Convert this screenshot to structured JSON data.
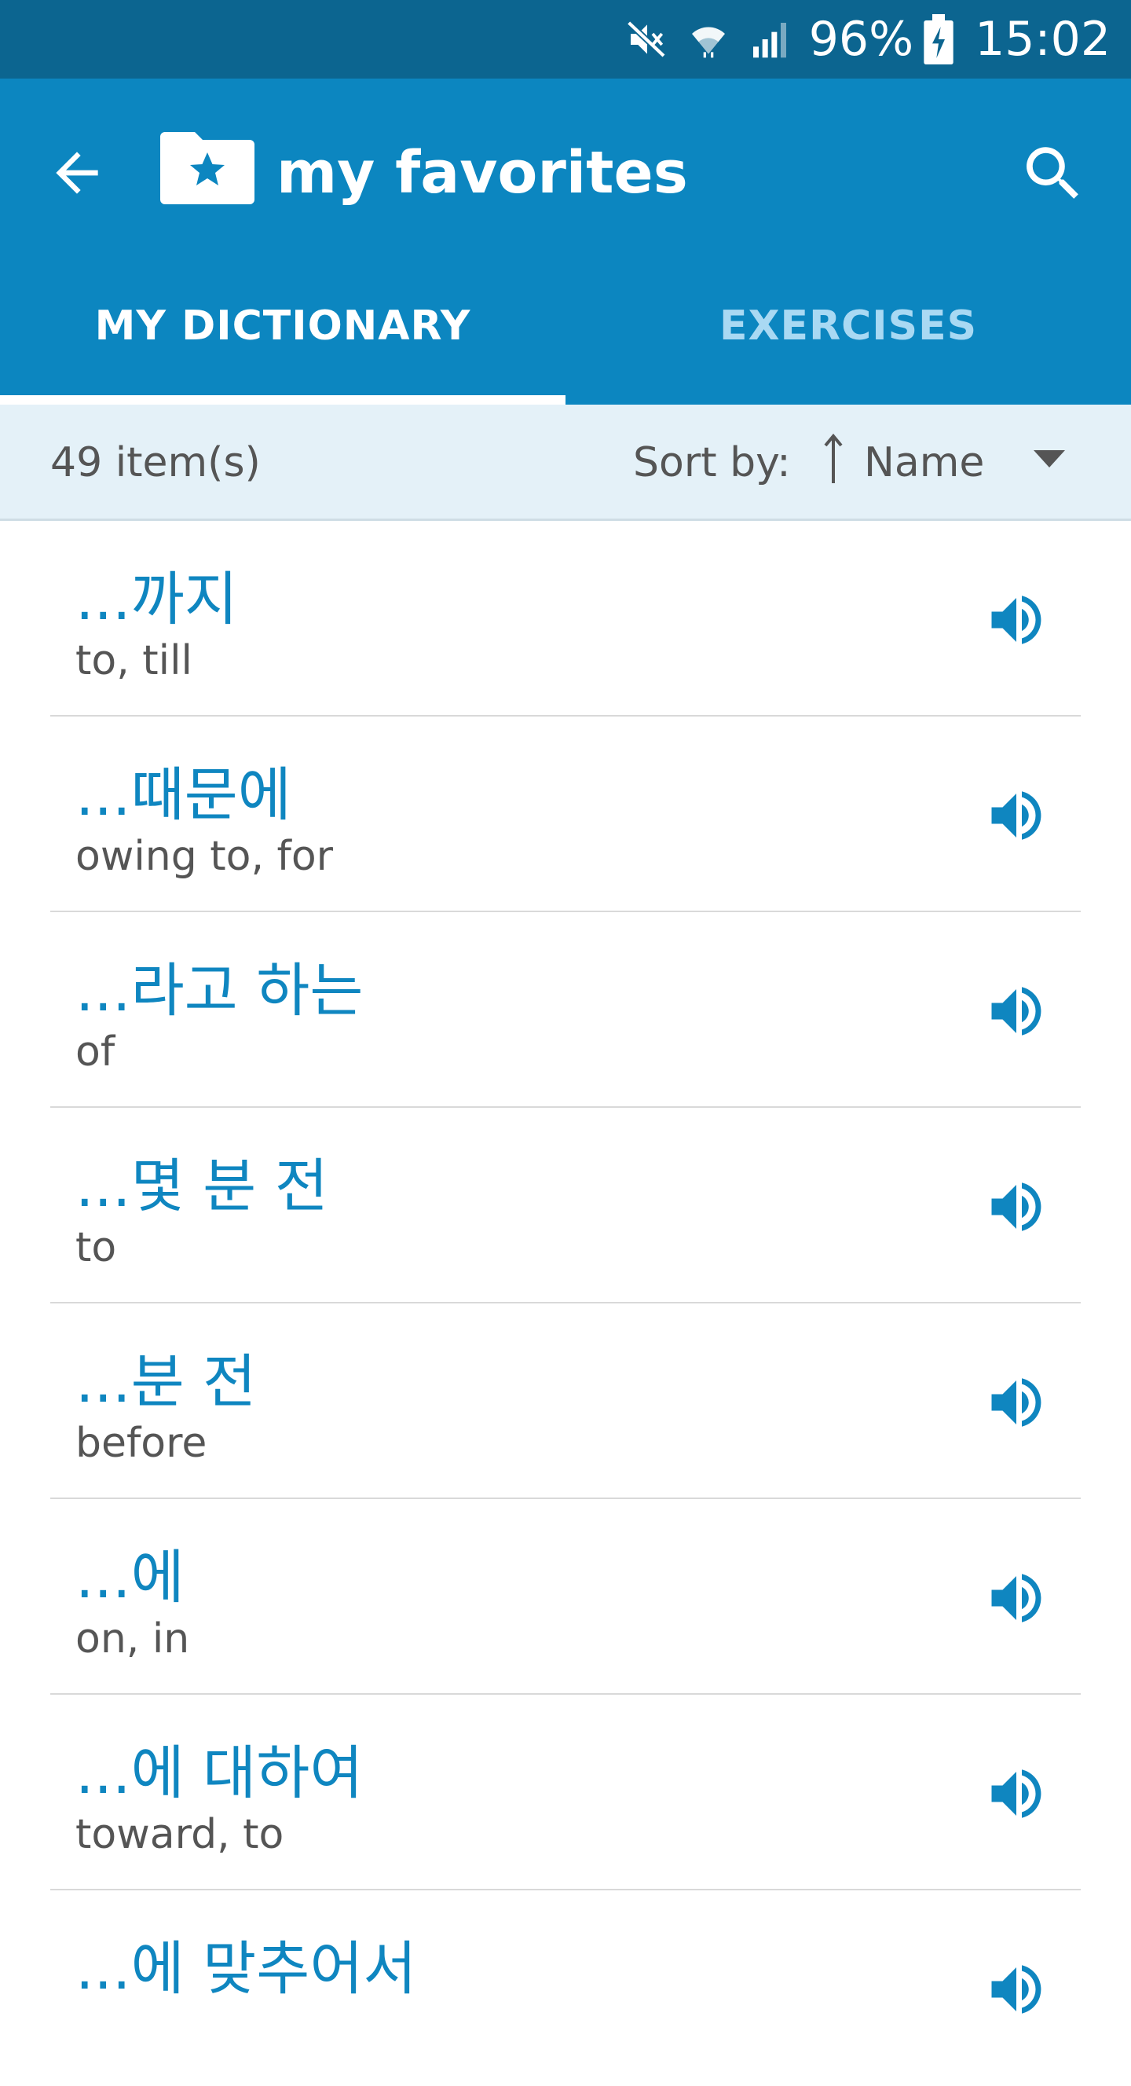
{
  "status_bar": {
    "battery": "96%",
    "time": "15:02",
    "icons": [
      "mute-icon",
      "wifi-icon",
      "signal-icon",
      "battery-charging-icon"
    ]
  },
  "app_bar": {
    "title": "my favorites",
    "icons": [
      "back-arrow-icon",
      "favorites-folder-icon",
      "search-icon"
    ],
    "tabs": [
      {
        "label": "MY DICTIONARY",
        "selected": true
      },
      {
        "label": "EXERCISES",
        "selected": false
      }
    ]
  },
  "sort_bar": {
    "count": "49 item(s)",
    "sort_label": "Sort by:",
    "sort_value": "Name",
    "icons": [
      "sort-ascending-icon",
      "dropdown-caret-icon"
    ]
  },
  "items": [
    {
      "term": "...까지",
      "meaning": "to, till"
    },
    {
      "term": "...때문에",
      "meaning": "owing to, for"
    },
    {
      "term": "...라고 하는",
      "meaning": "of"
    },
    {
      "term": "...몇 분 전",
      "meaning": "to"
    },
    {
      "term": "...분 전",
      "meaning": "before"
    },
    {
      "term": "...에",
      "meaning": "on, in"
    },
    {
      "term": "...에 대하여",
      "meaning": "toward, to"
    },
    {
      "term": "...에 맞추어서",
      "meaning": ""
    }
  ],
  "colors": {
    "status_bar": "#0c6590",
    "app_bar": "#0c86c0",
    "accent": "#0f86c0",
    "sort_bar": "#e4f1f8",
    "inactive_tab": "#a9d9f3"
  }
}
